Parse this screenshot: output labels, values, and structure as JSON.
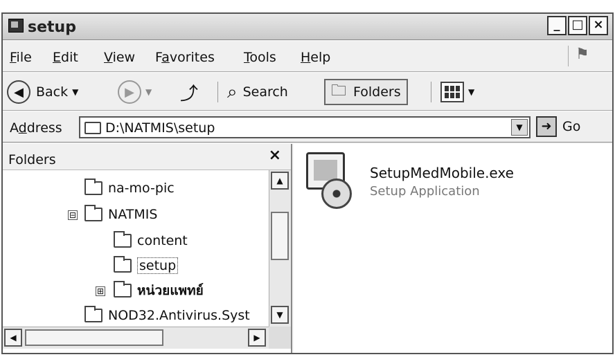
{
  "window": {
    "title": "setup",
    "minimize": "_",
    "maximize": "□",
    "close": "×"
  },
  "menu": {
    "items": [
      {
        "u": "F",
        "rest": "ile"
      },
      {
        "u": "E",
        "rest": "dit"
      },
      {
        "u": "V",
        "rest": "iew"
      },
      {
        "pre": "F",
        "u": "a",
        "rest": "vorites"
      },
      {
        "u": "T",
        "rest": "ools"
      },
      {
        "u": "H",
        "rest": "elp"
      }
    ]
  },
  "toolbar": {
    "back_label": "Back",
    "search_label": "Search",
    "folders_label": "Folders"
  },
  "address": {
    "label_pre": "A",
    "label_u": "d",
    "label_rest": "dress",
    "value": "D:\\NATMIS\\setup",
    "go_label": "Go"
  },
  "folders_pane": {
    "title": "Folders",
    "close": "×",
    "tree": [
      {
        "label": "na-mo-pic"
      },
      {
        "label": "NATMIS",
        "expander": "⊟"
      },
      {
        "label": "content"
      },
      {
        "label": "setup"
      },
      {
        "label": "หน่วยแพทย์",
        "expander": "⊞"
      },
      {
        "label": "NOD32.Antivirus.Syst"
      }
    ]
  },
  "files": [
    {
      "name": "SetupMedMobile.exe",
      "type": "Setup Application"
    }
  ]
}
